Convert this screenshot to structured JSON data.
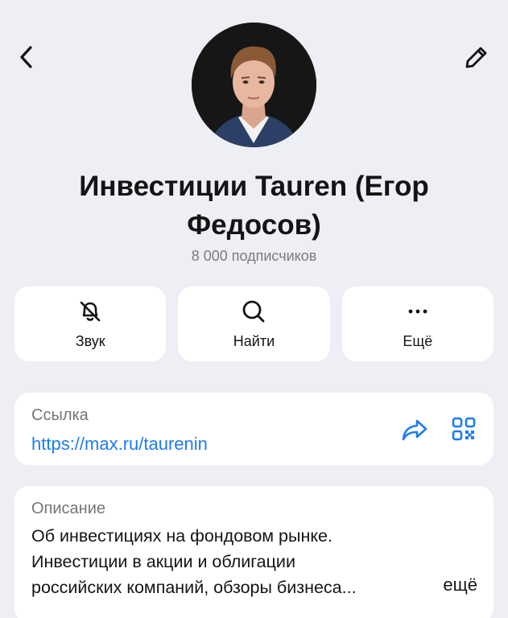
{
  "header": {
    "back_icon": "chevron-left-icon",
    "edit_icon": "pencil-icon"
  },
  "channel": {
    "title": "Инвестиции Tauren (Егор Федосов)",
    "subscribers": "8 000 подписчиков"
  },
  "actions": [
    {
      "label": "Звук",
      "icon": "bell-off-icon"
    },
    {
      "label": "Найти",
      "icon": "search-icon"
    },
    {
      "label": "Ещё",
      "icon": "more-icon"
    }
  ],
  "link_card": {
    "title": "Ссылка",
    "url": "https://max.ru/taurenin",
    "accent": "#1d7cf2"
  },
  "description_card": {
    "title": "Описание",
    "lines": [
      "Об инвестициях на фондовом рынке.",
      "Инвестиции в акции и облигации",
      "российских компаний, обзоры бизнеса..."
    ],
    "more_label": "ещё"
  }
}
